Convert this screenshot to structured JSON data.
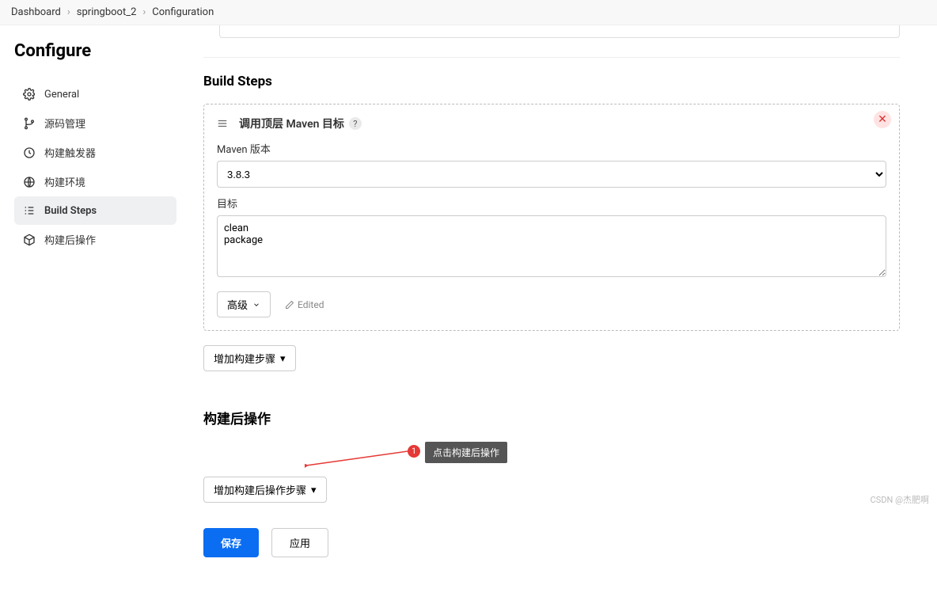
{
  "breadcrumb": {
    "items": [
      "Dashboard",
      "springboot_2",
      "Configuration"
    ]
  },
  "sidebar": {
    "title": "Configure",
    "items": [
      {
        "label": "General"
      },
      {
        "label": "源码管理"
      },
      {
        "label": "构建触发器"
      },
      {
        "label": "构建环境"
      },
      {
        "label": "Build Steps"
      },
      {
        "label": "构建后操作"
      }
    ]
  },
  "buildSteps": {
    "heading": "Build Steps",
    "step": {
      "title": "调用顶层 Maven 目标",
      "help": "?",
      "mavenVersionLabel": "Maven 版本",
      "mavenVersionValue": "3.8.3",
      "goalsLabel": "目标",
      "goalsValue": "clean\npackage",
      "advancedLabel": "高级",
      "editedLabel": "Edited"
    },
    "addStepLabel": "增加构建步骤"
  },
  "postBuild": {
    "heading": "构建后操作",
    "addActionLabel": "增加构建后操作步骤",
    "callout": {
      "num": "1",
      "text": "点击构建后操作"
    }
  },
  "footer": {
    "save": "保存",
    "apply": "应用"
  },
  "watermark": "CSDN @杰肥啊"
}
